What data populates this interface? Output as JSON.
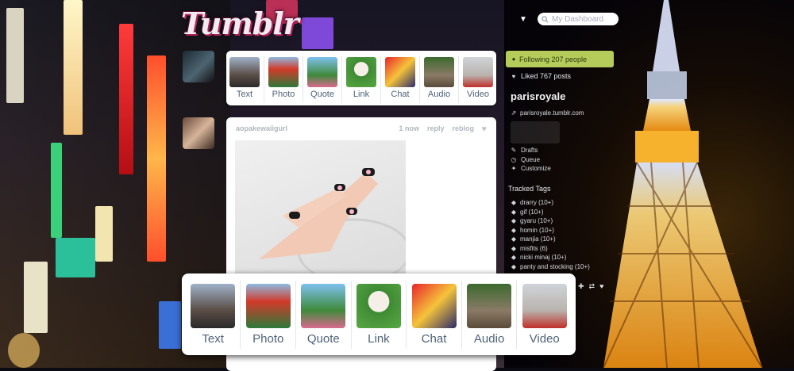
{
  "header": {
    "logo_text": "Tumblr",
    "search_placeholder": "My Dashboard"
  },
  "post_types": [
    {
      "label": "Text"
    },
    {
      "label": "Photo"
    },
    {
      "label": "Quote"
    },
    {
      "label": "Link"
    },
    {
      "label": "Chat"
    },
    {
      "label": "Audio"
    },
    {
      "label": "Video"
    }
  ],
  "post": {
    "username": "aopakewaiigurl",
    "time": "1 now",
    "reply": "reply",
    "reblog": "reblog"
  },
  "sidebar": {
    "following": "Following 207 people",
    "liked": "Liked 767 posts",
    "blog_name": "parisroyale",
    "blog_url": "parisroyale.tumblr.com",
    "links": [
      {
        "label": "Drafts",
        "icon": "pencil-icon"
      },
      {
        "label": "Queue",
        "icon": "clock-icon"
      },
      {
        "label": "Customize",
        "icon": "wrench-icon"
      }
    ],
    "tracked_tags_title": "Tracked Tags",
    "tracked_tags": [
      "drarry (10+)",
      "gif (10+)",
      "gyaru (10+)",
      "homin (10+)",
      "manjia (10+)",
      "misfits (6)",
      "nicki minaj (10+)",
      "panty and stocking (10+)"
    ]
  },
  "colors": {
    "following_bg": "#b5cc5a",
    "label_text": "#4f6278",
    "muted_text": "#b0b7be"
  }
}
